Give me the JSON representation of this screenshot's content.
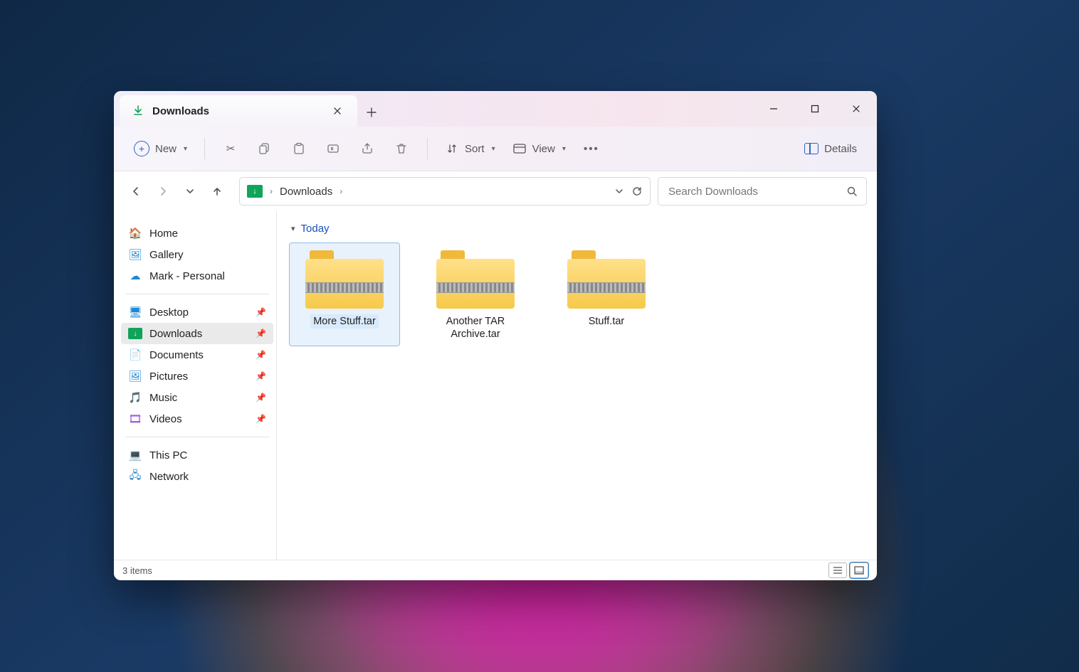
{
  "tab": {
    "title": "Downloads"
  },
  "toolbar": {
    "new_label": "New",
    "sort_label": "Sort",
    "view_label": "View",
    "details_label": "Details"
  },
  "breadcrumb": {
    "location": "Downloads"
  },
  "search": {
    "placeholder": "Search Downloads"
  },
  "sidebar": {
    "top": [
      {
        "label": "Home"
      },
      {
        "label": "Gallery"
      },
      {
        "label": "Mark - Personal"
      }
    ],
    "quick": [
      {
        "label": "Desktop"
      },
      {
        "label": "Downloads"
      },
      {
        "label": "Documents"
      },
      {
        "label": "Pictures"
      },
      {
        "label": "Music"
      },
      {
        "label": "Videos"
      }
    ],
    "bottom": [
      {
        "label": "This PC"
      },
      {
        "label": "Network"
      }
    ]
  },
  "content": {
    "group_label": "Today",
    "files": [
      {
        "name": "More Stuff.tar"
      },
      {
        "name": "Another TAR Archive.tar"
      },
      {
        "name": "Stuff.tar"
      }
    ]
  },
  "status": {
    "text": "3 items"
  }
}
